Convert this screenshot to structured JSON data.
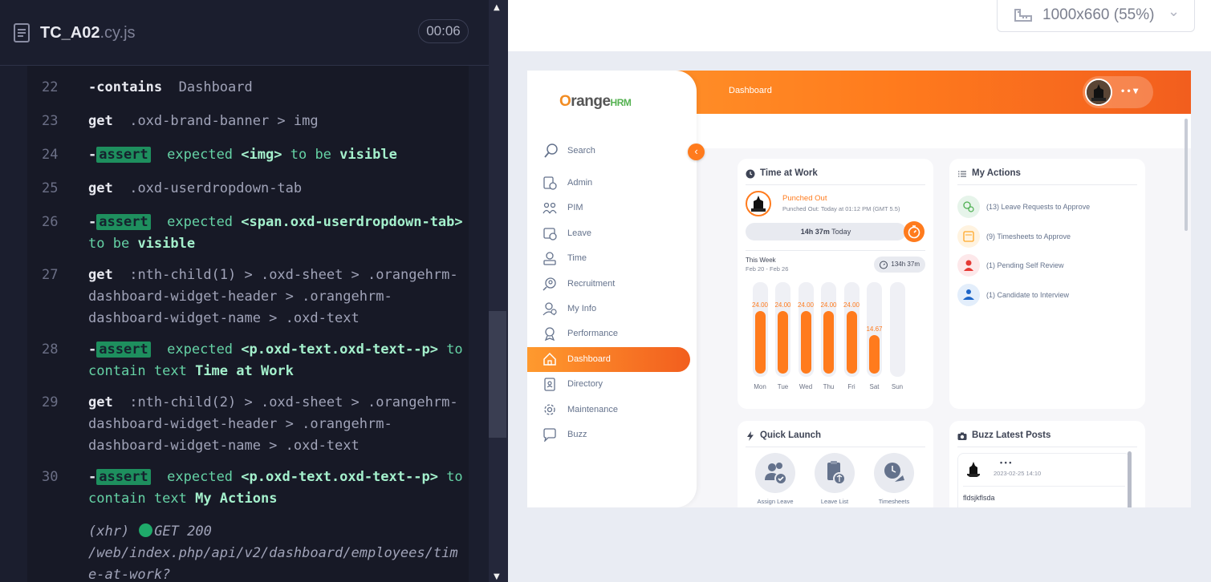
{
  "spec": {
    "name": "TC_A02",
    "ext": ".cy.js",
    "timer": "00:06"
  },
  "commands": [
    {
      "line": "22",
      "kind": "contains",
      "name": "contains",
      "arg": "Dashboard"
    },
    {
      "line": "23",
      "kind": "get",
      "name": "get",
      "arg": ".oxd-brand-banner > img"
    },
    {
      "line": "24",
      "kind": "assert",
      "badge": "assert",
      "w1": "expected",
      "subject": "<img>",
      "w2": "to be",
      "target": "visible"
    },
    {
      "line": "25",
      "kind": "get",
      "name": "get",
      "arg": ".oxd-userdropdown-tab"
    },
    {
      "line": "26",
      "kind": "assert",
      "badge": "assert",
      "w1": "expected",
      "subject": "<span.oxd-userdropdown-tab>",
      "w2": "to be",
      "target": "visible"
    },
    {
      "line": "27",
      "kind": "get",
      "name": "get",
      "arg": ":nth-child(1) > .oxd-sheet > .orangehrm-dashboard-widget-header > .orangehrm-dashboard-widget-name > .oxd-text"
    },
    {
      "line": "28",
      "kind": "assert",
      "badge": "assert",
      "w1": "expected",
      "subject": "<p.oxd-text.oxd-text--p>",
      "w2": "to contain text",
      "target": "Time at Work"
    },
    {
      "line": "29",
      "kind": "get",
      "name": "get",
      "arg": ":nth-child(2) > .oxd-sheet > .orangehrm-dashboard-widget-header > .orangehrm-dashboard-widget-name > .oxd-text"
    },
    {
      "line": "30",
      "kind": "assert",
      "badge": "assert",
      "w1": "expected",
      "subject": "<p.oxd-text.oxd-text--p>",
      "w2": "to contain text",
      "target": "My Actions"
    }
  ],
  "xhr": {
    "label": "(xhr)",
    "method": "GET 200",
    "url": "/web/index.php/api/v2/dashboard/employees/time-at-work?"
  },
  "viewport": {
    "text": "1000x660",
    "scale": "(55%)"
  },
  "app": {
    "page_title": "Dashboard",
    "user_menu": "• • ▾",
    "logo": {
      "o": "O",
      "range": "range",
      "hrm": "HRM"
    },
    "search_label": "Search",
    "menu": [
      "Admin",
      "PIM",
      "Leave",
      "Time",
      "Recruitment",
      "My Info",
      "Performance",
      "Dashboard",
      "Directory",
      "Maintenance",
      "Buzz"
    ],
    "active_menu": "Dashboard",
    "time_at_work": {
      "title": "Time at Work",
      "status": "Punched Out",
      "status_detail": "Punched Out: Today at 01:12 PM (GMT 5.5)",
      "today_hours": "14h 37m",
      "today_label": "Today",
      "week_label": "This Week",
      "week_range": "Feb 20 - Feb 26",
      "week_total": "134h 37m"
    },
    "my_actions": {
      "title": "My Actions",
      "items": [
        {
          "label": "(13) Leave Requests to Approve",
          "color": "#e6f4ea"
        },
        {
          "label": "(9) Timesheets to Approve",
          "color": "#fff3e0"
        },
        {
          "label": "(1) Pending Self Review",
          "color": "#fde8ea"
        },
        {
          "label": "(1) Candidate to Interview",
          "color": "#e3eefb"
        }
      ]
    },
    "quick_launch": {
      "title": "Quick Launch",
      "items": [
        "Assign Leave",
        "Leave List",
        "Timesheets"
      ]
    },
    "buzz": {
      "title": "Buzz Latest Posts",
      "author": "• • •",
      "time": "2023-02-25 14:10",
      "text": "fldsjkflsda"
    }
  },
  "chart_data": {
    "type": "bar",
    "categories": [
      "Mon",
      "Tue",
      "Wed",
      "Thu",
      "Fri",
      "Sat",
      "Sun"
    ],
    "values": [
      24.0,
      24.0,
      24.0,
      24.0,
      24.0,
      14.67,
      0
    ],
    "value_labels": [
      "24.00",
      "24.00",
      "24.00",
      "24.00",
      "24.00",
      "14.67",
      ""
    ],
    "ylim": [
      0,
      24
    ],
    "color": "#ff7b1d"
  }
}
